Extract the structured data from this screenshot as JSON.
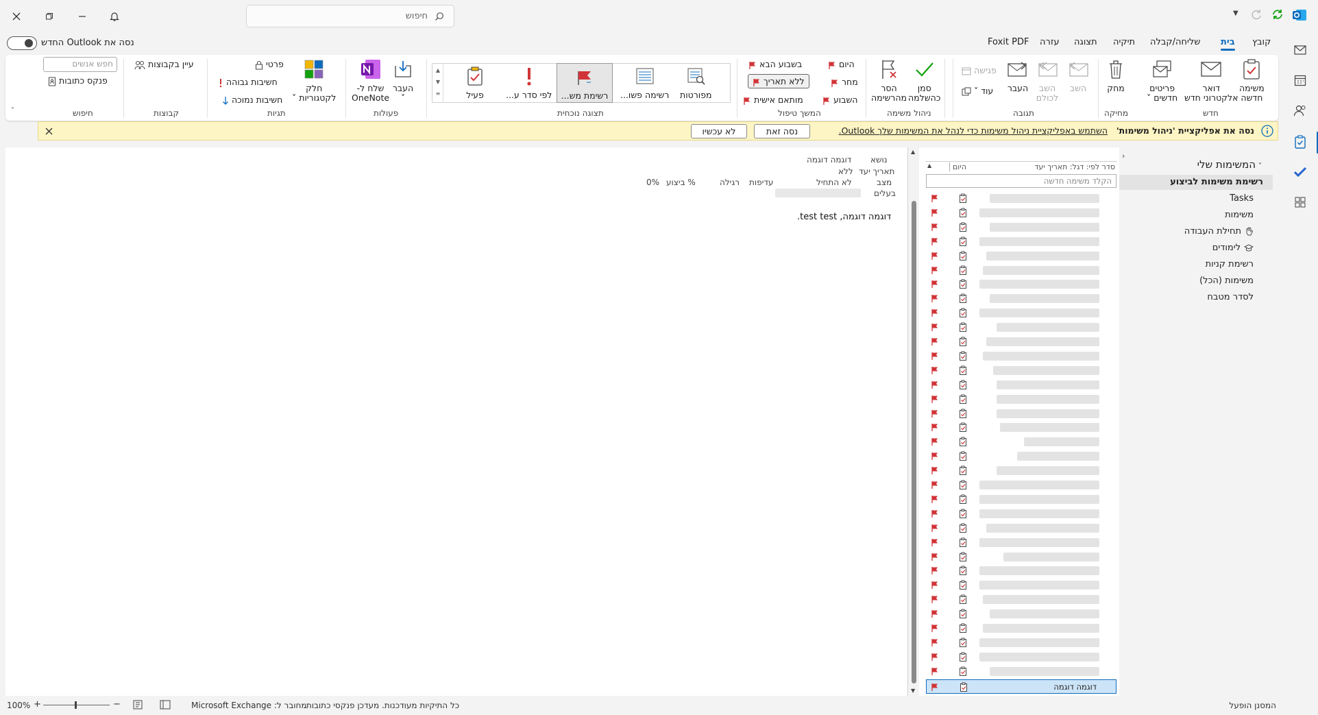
{
  "titlebar": {
    "search_placeholder": "חיפוש",
    "buttons": {
      "close": "close-icon",
      "restore": "restore-icon",
      "minimize": "minimize-icon",
      "bell": "bell-icon"
    }
  },
  "menu": {
    "tabs": [
      {
        "id": "file",
        "label": "קובץ"
      },
      {
        "id": "home",
        "label": "בית"
      },
      {
        "id": "send",
        "label": "שליחה/קבלה"
      },
      {
        "id": "folder",
        "label": "תיקיה"
      },
      {
        "id": "view",
        "label": "תצוגה"
      },
      {
        "id": "help",
        "label": "עזרה"
      },
      {
        "id": "foxit",
        "label": "Foxit PDF"
      }
    ],
    "try_new": "נסה את Outlook החדש"
  },
  "ribbon": {
    "groups": {
      "new": "חדש",
      "delete": "מחיקה",
      "respond": "תגובה",
      "manage": "ניהול משימה",
      "followup": "המשך טיפול",
      "current_view": "תצוגה נוכחית",
      "actions": "פעולות",
      "tags": "תגיות",
      "groups": "קבוצות",
      "find": "חיפוש"
    },
    "new_task": [
      "משימה",
      "חדשה"
    ],
    "new_email": [
      "דואר",
      "אלקטרוני חדש"
    ],
    "new_items": [
      "פריטים",
      "חדשים ˅"
    ],
    "delete": "מחק",
    "reply": "השב",
    "reply_all": [
      "השב",
      "לכולם"
    ],
    "forward": "העבר",
    "meeting": "פגישה",
    "more": "עוד ˅",
    "mark_complete": [
      "סמן",
      "כהשלמה"
    ],
    "remove_from_list": [
      "הסר",
      "מהרשימה"
    ],
    "followup": {
      "today": "היום",
      "tomorrow": "מחר",
      "this_week": "השבוע",
      "next_week": "בשבוע הבא",
      "no_date": "ללא תאריך",
      "custom": "מותאם אישית"
    },
    "views": [
      "מפורטות",
      "רשימה פשו...",
      "רשימת מש...",
      "לפי סדר ע...",
      "פעיל"
    ],
    "move": [
      "העבר",
      "˅"
    ],
    "onenote": [
      "שלח ל-",
      "OneNote"
    ],
    "categorize": [
      "חלק",
      "לקטגוריות ˅"
    ],
    "private": "פרטי",
    "high_importance": "חשיבות גבוהה",
    "low_importance": "חשיבות נמוכה",
    "browse_groups": "עיין בקבוצות",
    "search_people_placeholder": "חפש אנשים",
    "address_book": "פנקס כתובות"
  },
  "infobar": {
    "bold": "נסה את אפליקציית 'ניהול משימות'",
    "link": "השתמש באפליקציית ניהול משימות כדי לנהל את המשימות שלך Outlook.",
    "try_btn": "נסה זאת",
    "later_btn": "לא עכשיו"
  },
  "folders": {
    "header": "המשימות שלי",
    "items": [
      {
        "label": "רשימת משימות לביצוע",
        "selected": true,
        "icon": ""
      },
      {
        "label": "Tasks",
        "selected": false,
        "icon": ""
      },
      {
        "label": "משימות",
        "selected": false,
        "icon": ""
      },
      {
        "label": "תחילת העבודה",
        "selected": false,
        "icon": "hand-icon"
      },
      {
        "label": "לימודים",
        "selected": false,
        "icon": "grad-cap-icon"
      },
      {
        "label": "רשימת קניות",
        "selected": false,
        "icon": ""
      },
      {
        "label": "משימות (הכל)",
        "selected": false,
        "icon": ""
      },
      {
        "label": "לסדר מטבח",
        "selected": false,
        "icon": ""
      }
    ]
  },
  "tasklist": {
    "sort_label": "סדר לפי: דגל: תאריך יעד",
    "group_label": "היום",
    "new_task_placeholder": "הקלד משימה חדשה",
    "selected_task": "דוגמה דוגמה"
  },
  "reading": {
    "subject_label": "נושא",
    "subject_value": "דוגמה דוגמה",
    "due_label": "תאריך יעד",
    "due_value": "ללא",
    "status_label": "מצב",
    "status_value": "לא התחיל",
    "priority_label": "עדיפות",
    "priority_value": "רגילה",
    "percent_label": "% ביצוע",
    "percent_value": "0%",
    "owner_label": "בעלים",
    "body": "דוגמה דוגמה, test test."
  },
  "status": {
    "filter": "המסנן הופעל",
    "folders": "כל התיקיות מעודכנות. מעדכן פנקסי כתובות.",
    "connection": "מחובר ל: Microsoft Exchange",
    "zoom": "100%"
  },
  "colors": {
    "accent": "#0f6cbd",
    "flag": "#d13438",
    "info_bg": "#fdf5c4",
    "selected_row": "#cce4f7"
  }
}
